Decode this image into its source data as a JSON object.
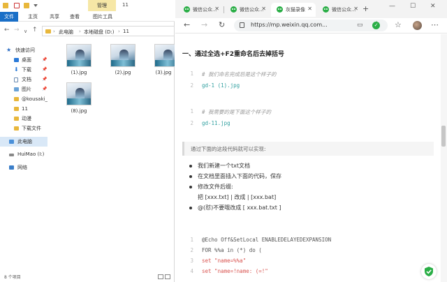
{
  "explorer": {
    "window_title": "11",
    "manage_tab": "管理",
    "ribbon_tabs": [
      "文件",
      "主页",
      "共享",
      "查看",
      "图片工具"
    ],
    "breadcrumb": [
      "此电脑",
      "本地磁盘 (D:)",
      "11"
    ],
    "sidebar": [
      {
        "label": "快速访问",
        "icon": "star-icon",
        "pinned": false
      },
      {
        "label": "桌面",
        "icon": "desktop-icon",
        "pinned": true
      },
      {
        "label": "下载",
        "icon": "download-icon",
        "pinned": true
      },
      {
        "label": "文档",
        "icon": "document-icon",
        "pinned": true
      },
      {
        "label": "图片",
        "icon": "picture-icon",
        "pinned": true
      },
      {
        "label": "@kousaki_r",
        "icon": "folder-icon",
        "pinned": false
      },
      {
        "label": "11",
        "icon": "folder-icon",
        "pinned": false
      },
      {
        "label": "动漫",
        "icon": "folder-icon",
        "pinned": false
      },
      {
        "label": "下载文件",
        "icon": "folder-icon",
        "pinned": false
      },
      {
        "label": "此电脑",
        "icon": "computer-icon",
        "pinned": false
      },
      {
        "label": "HuiMao (I:)",
        "icon": "drive-icon",
        "pinned": false
      },
      {
        "label": "网络",
        "icon": "network-icon",
        "pinned": false
      }
    ],
    "files": [
      "(1).jpg",
      "(2).jpg",
      "(3).jpg",
      "(8).jpg"
    ],
    "status": "8 个项目"
  },
  "browser": {
    "tabs": [
      {
        "title": "微信公众...",
        "active": false
      },
      {
        "title": "微信公众...",
        "active": false
      },
      {
        "title": "灰猫录像",
        "active": true
      },
      {
        "title": "微信公众...",
        "active": false
      }
    ],
    "url": "https://mp.weixin.qq.com...",
    "heading": "一、通过全选+F2重命名后去掉括号",
    "code_block_1": [
      {
        "n": "1",
        "text": "# 我们命名完成后是这个样子的",
        "kind": "comment"
      },
      {
        "n": "2",
        "text": "gd-1 (1).jpg",
        "kind": "mixed"
      }
    ],
    "code_block_2": [
      {
        "n": "1",
        "text": "# 我需要的是下面这个样子的",
        "kind": "comment"
      },
      {
        "n": "2",
        "text": "gd-11.jpg",
        "kind": "teal"
      }
    ],
    "quote": "通过下面的这段代码就可以实现:",
    "bullets": [
      {
        "text": "我们新建一个txt文档",
        "dot": true
      },
      {
        "text": "在文档里面插入下面的代码，保存",
        "dot": true
      },
      {
        "text": "修改文件后缀:",
        "dot": true
      },
      {
        "text": "把 [xxx.txt] | 改成 | [xxx.bat]",
        "dot": false
      },
      {
        "text": "@(怼)不要哦改成 [ xxx.bat.txt ]",
        "dot": true
      }
    ],
    "code_block_3": [
      {
        "n": "1",
        "text": "@Echo Off&SetLocal ENABLEDELAYEDEXPANSION",
        "kind": "plain"
      },
      {
        "n": "2",
        "text": "FOR %%a in (*) do (",
        "kind": "plain"
      },
      {
        "n": "3",
        "text": "set \"name=%%a\"",
        "kind": "red"
      },
      {
        "n": "4",
        "text": "set \"name=!name: (=!\"",
        "kind": "red"
      }
    ]
  },
  "colors": {
    "accent": "#1a6fc7",
    "wechat_green": "#2aae46",
    "manage_yellow": "#f6e7a6",
    "code_teal": "#2e9e9e"
  }
}
